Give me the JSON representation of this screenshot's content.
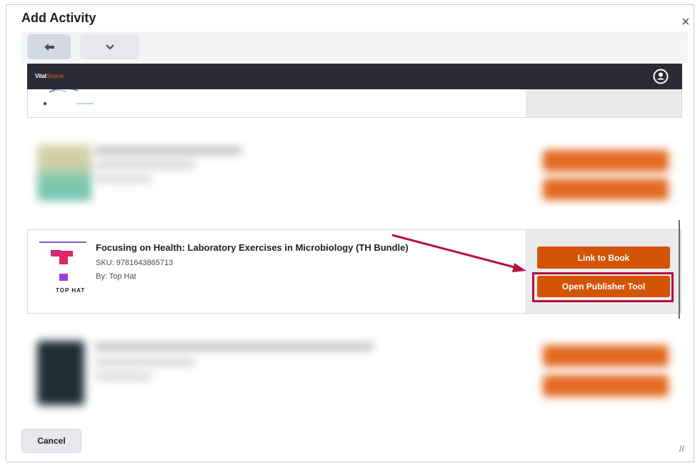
{
  "dialog": {
    "title": "Add Activity",
    "close_glyph": "×",
    "cancel_label": "Cancel",
    "resize_glyph": "//"
  },
  "toolbar": {
    "back_icon": "arrow-left-icon",
    "dropdown_icon": "chevron-down-icon"
  },
  "vitalsource": {
    "brand_main": "Vital",
    "brand_accent": "Source",
    "user_icon": "user-circle-icon"
  },
  "product": {
    "title": "Focusing on Health: Laboratory Exercises in Microbiology (TH Bundle)",
    "sku": "SKU: 9781643865713",
    "by": "By: Top Hat",
    "logo_text": "TOP HAT",
    "link_label": "Link to Book",
    "publisher_label": "Open Publisher Tool"
  },
  "colors": {
    "accent_orange": "#d35407",
    "highlight": "#b3123e",
    "header_dark": "#2b2c33"
  }
}
